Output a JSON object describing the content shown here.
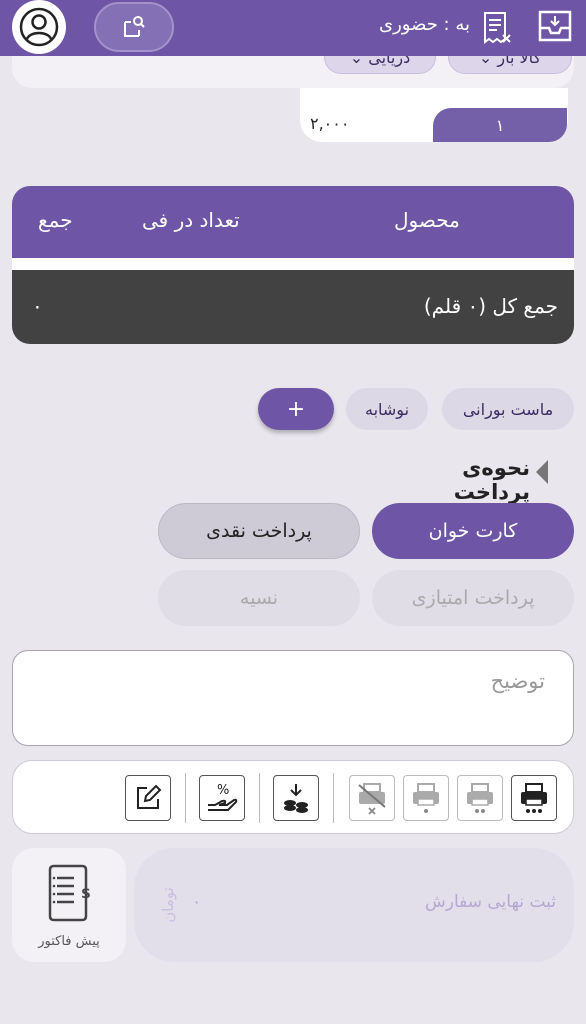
{
  "header": {
    "order_type": "به : حضوری",
    "icons": [
      "user-avatar-icon",
      "qr-scan-icon",
      "receipt-cancel-icon",
      "inbox-icon"
    ]
  },
  "top_card": {
    "chips": [
      {
        "label": "کالا بار"
      },
      {
        "label": "دریایی"
      }
    ],
    "price": "۲,۰۰۰",
    "quantity": "۱"
  },
  "table": {
    "headers": {
      "product": "محصول",
      "qty_price": "تعداد در فی",
      "sum": "جمع"
    },
    "total_label": "جمع کل (۰ قلم)",
    "total_value": "۰"
  },
  "categories": [
    {
      "label": "ماست بورانی"
    },
    {
      "label": "نوشابه"
    }
  ],
  "add_label": "+",
  "payment": {
    "title": "نحوه‌ی پرداخت",
    "options": [
      {
        "label": "کارت خوان",
        "state": "selected"
      },
      {
        "label": "پرداخت نقدی",
        "state": "normal"
      },
      {
        "label": "پرداخت امتیازی",
        "state": "disabled"
      },
      {
        "label": "نسیه",
        "state": "disabled"
      }
    ]
  },
  "description": {
    "placeholder": "توضیح"
  },
  "toolbar_icons": [
    "printer-three-dots-icon",
    "printer-two-dots-icon",
    "printer-one-dot-icon",
    "printer-disabled-icon",
    "coins-download-icon",
    "discount-hand-icon",
    "edit-icon"
  ],
  "footer": {
    "prefactor_label": "پیش فاکتور",
    "submit_label": "ثبت نهایی سفارش",
    "amount": "۰",
    "currency": "تومان"
  },
  "colors": {
    "primary": "#6f55a6",
    "dark": "#424242",
    "background": "#e9e6ee"
  }
}
